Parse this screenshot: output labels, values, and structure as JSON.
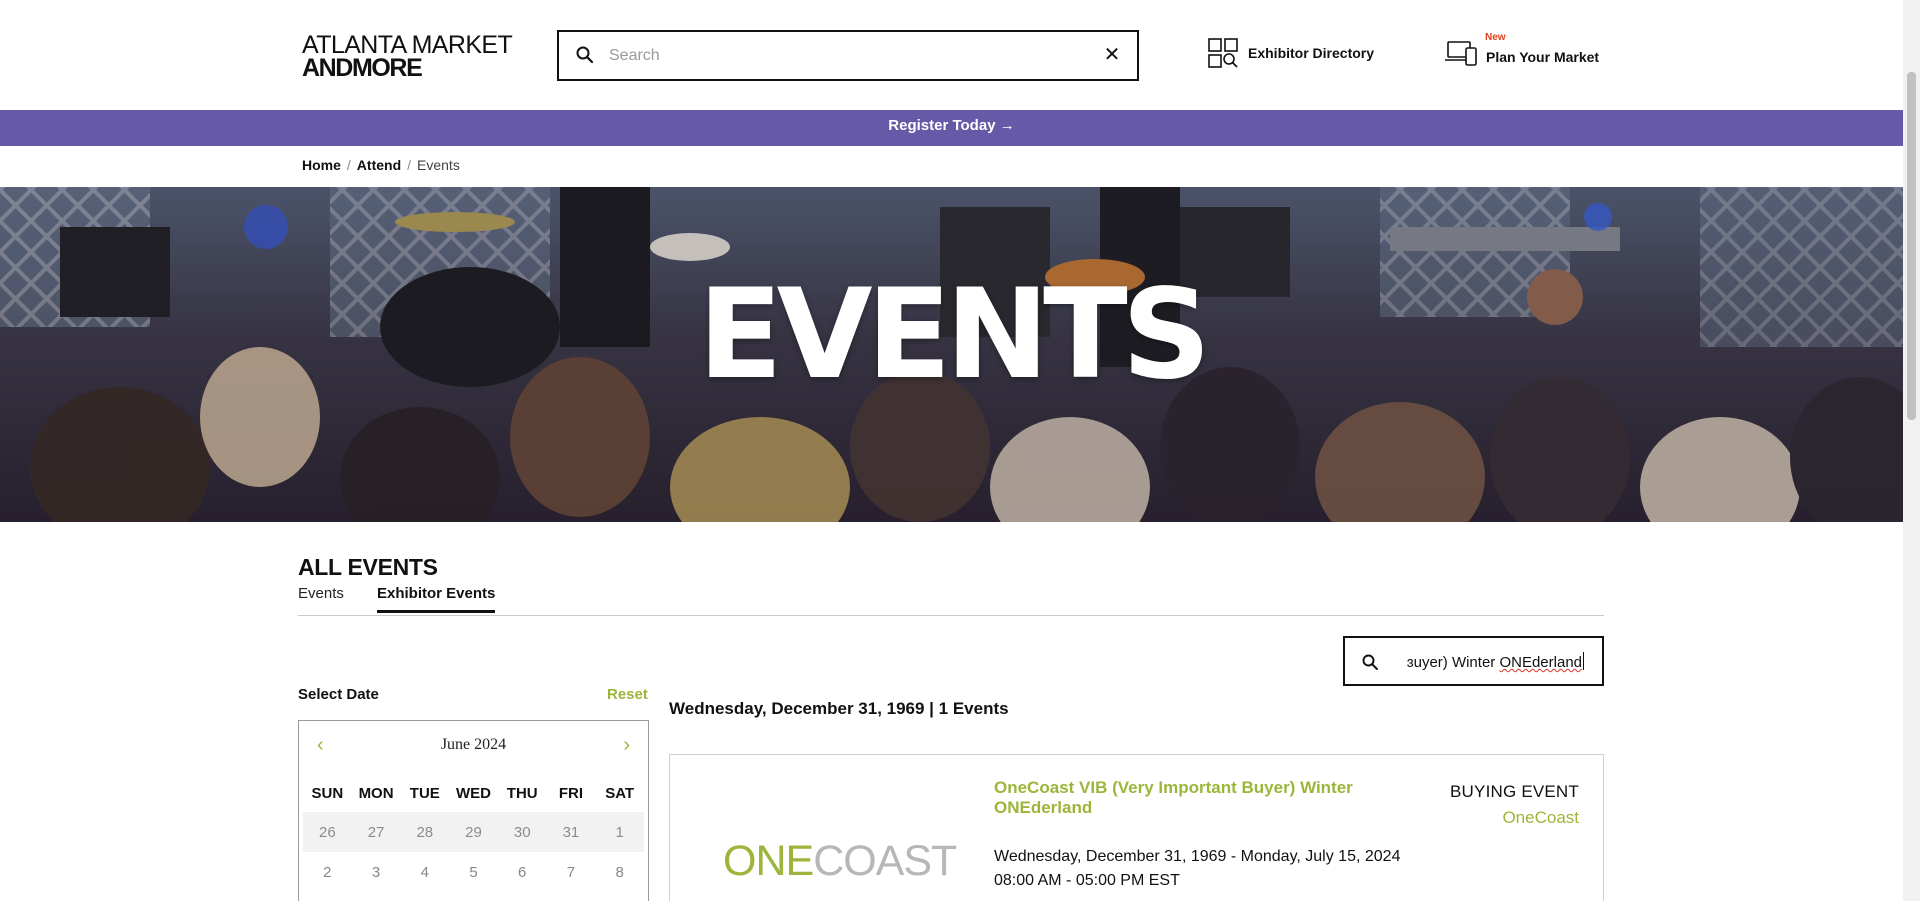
{
  "header": {
    "logo_line1": "ATLANTA MARKET",
    "logo_line2": "ANDMORE",
    "search_placeholder": "Search",
    "search_value": "",
    "clear_symbol": "✕",
    "nav": {
      "exhibitor_directory": "Exhibitor Directory",
      "plan_your_market": "Plan Your Market",
      "plan_badge": "New"
    }
  },
  "promo": {
    "register_label": "Register Today →"
  },
  "breadcrumb": {
    "home": "Home",
    "attend": "Attend",
    "current": "Events",
    "separator": "/"
  },
  "hero": {
    "title": "EVENTS"
  },
  "section": {
    "title": "ALL EVENTS",
    "tabs": [
      "Events",
      "Exhibitor Events"
    ],
    "active_tab": "Exhibitor Events"
  },
  "filter": {
    "text_prefix": "ɜuyer) Winter ",
    "text_misspelled": "ONEderland"
  },
  "date_picker": {
    "label": "Select Date",
    "reset_label": "Reset",
    "month_label": "June 2024",
    "prev_symbol": "‹",
    "next_symbol": "›",
    "weekdays": [
      "SUN",
      "MON",
      "TUE",
      "WED",
      "THU",
      "FRI",
      "SAT"
    ],
    "weeks": [
      [
        "26",
        "27",
        "28",
        "29",
        "30",
        "31",
        "1"
      ],
      [
        "2",
        "3",
        "4",
        "5",
        "6",
        "7",
        "8"
      ]
    ]
  },
  "results": {
    "header": "Wednesday, December 31, 1969 | 1 Events",
    "events": [
      {
        "logo_one": "ONE",
        "logo_coast": "COAST",
        "title": "OneCoast VIB (Very Important Buyer) Winter ONEderland",
        "type": "BUYING EVENT",
        "organizer": "OneCoast",
        "dates": "Wednesday, December 31, 1969 - Monday, July 15, 2024",
        "time": "08:00 AM - 05:00 PM EST"
      }
    ]
  },
  "colors": {
    "accent_green": "#9cb53a",
    "promo_purple": "#6559a8",
    "badge_red": "#e0401c",
    "text": "#111111"
  },
  "icons": {
    "search": "search-icon",
    "clear": "close-icon",
    "directory": "directory-icon",
    "plan": "devices-icon",
    "prev": "chevron-left-icon",
    "next": "chevron-right-icon"
  }
}
